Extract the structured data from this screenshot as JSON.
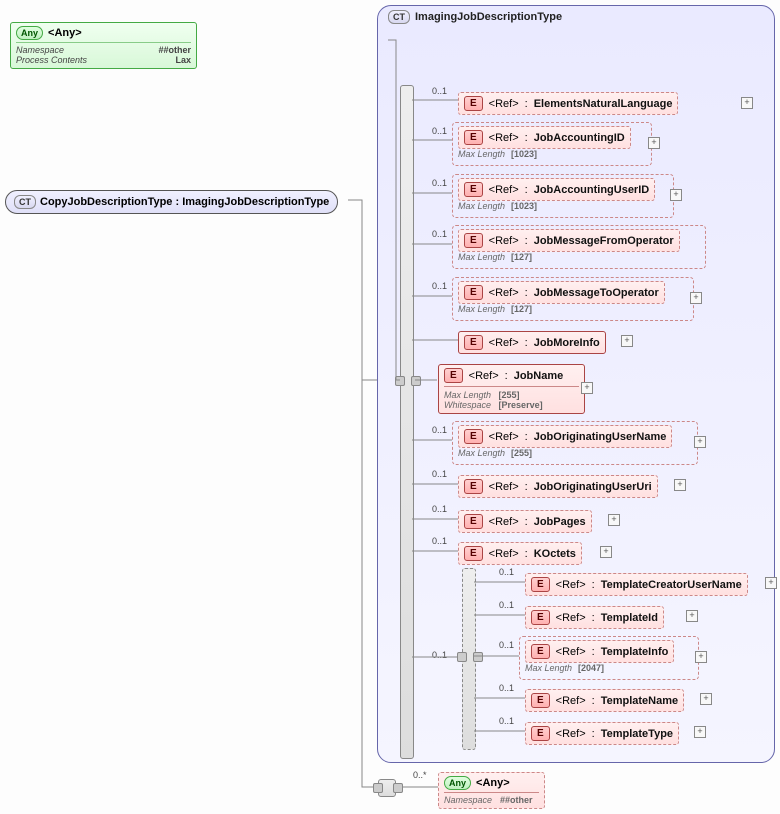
{
  "root": {
    "ct_badge": "CT",
    "label": "CopyJobDescriptionType : ImagingJobDescriptionType"
  },
  "container": {
    "ct_badge": "CT",
    "title": "ImagingJobDescriptionType"
  },
  "any_top": {
    "badge": "Any",
    "title": "<Any>",
    "rows": [
      {
        "k": "Namespace",
        "v": "##other"
      },
      {
        "k": "Process Contents",
        "v": "Lax"
      }
    ]
  },
  "elements": [
    {
      "occ": "0..1",
      "name": "ElementsNaturalLanguage",
      "dashed": true,
      "facets": []
    },
    {
      "occ": "0..1",
      "name": "JobAccountingID",
      "dashed": true,
      "facets": [
        {
          "k": "Max Length",
          "v": "[1023]"
        }
      ]
    },
    {
      "occ": "0..1",
      "name": "JobAccountingUserID",
      "dashed": true,
      "facets": [
        {
          "k": "Max Length",
          "v": "[1023]"
        }
      ]
    },
    {
      "occ": "0..1",
      "name": "JobMessageFromOperator",
      "dashed": true,
      "facets": [
        {
          "k": "Max Length",
          "v": "[127]"
        }
      ]
    },
    {
      "occ": "0..1",
      "name": "JobMessageToOperator",
      "dashed": true,
      "facets": [
        {
          "k": "Max Length",
          "v": "[127]"
        }
      ]
    },
    {
      "occ": "",
      "name": "JobMoreInfo",
      "dashed": false,
      "facets": []
    },
    {
      "occ": "",
      "name": "JobName",
      "dashed": false,
      "facets": [
        {
          "k": "Max Length",
          "v": "[255]"
        },
        {
          "k": "Whitespace",
          "v": "[Preserve]"
        }
      ]
    },
    {
      "occ": "0..1",
      "name": "JobOriginatingUserName",
      "dashed": true,
      "facets": [
        {
          "k": "Max Length",
          "v": "[255]"
        }
      ]
    },
    {
      "occ": "0..1",
      "name": "JobOriginatingUserUri",
      "dashed": true,
      "facets": []
    },
    {
      "occ": "0..1",
      "name": "JobPages",
      "dashed": true,
      "facets": []
    },
    {
      "occ": "0..1",
      "name": "KOctets",
      "dashed": true,
      "facets": []
    }
  ],
  "template_group": {
    "occ": "0..1",
    "items": [
      {
        "occ": "0..1",
        "name": "TemplateCreatorUserName",
        "dashed": true,
        "facets": []
      },
      {
        "occ": "0..1",
        "name": "TemplateId",
        "dashed": true,
        "facets": []
      },
      {
        "occ": "0..1",
        "name": "TemplateInfo",
        "dashed": true,
        "facets": [
          {
            "k": "Max Length",
            "v": "[2047]"
          }
        ]
      },
      {
        "occ": "0..1",
        "name": "TemplateName",
        "dashed": true,
        "facets": []
      },
      {
        "occ": "0..1",
        "name": "TemplateType",
        "dashed": true,
        "facets": []
      }
    ]
  },
  "any_footer": {
    "occ": "0..*",
    "badge": "Any",
    "title": "<Any>",
    "rows": [
      {
        "k": "Namespace",
        "v": "##other"
      }
    ]
  },
  "labels": {
    "ref": "<Ref>",
    "e": "E"
  }
}
